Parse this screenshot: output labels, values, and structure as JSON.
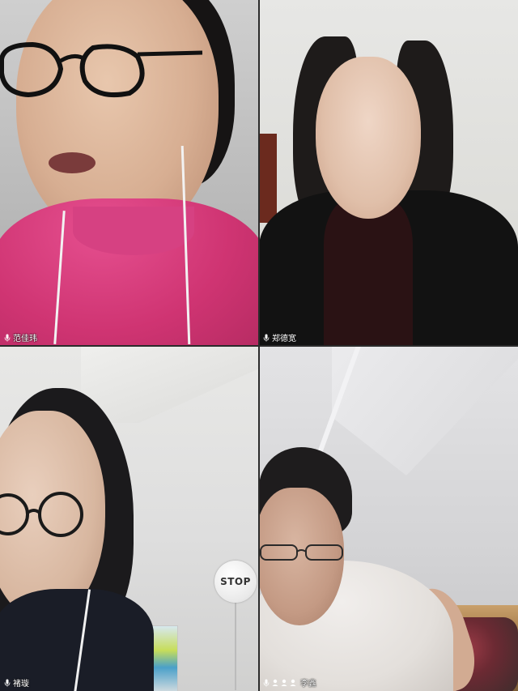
{
  "participants": [
    {
      "name": "范佳玮",
      "icon": "microphone-icon"
    },
    {
      "name": "郑德宽",
      "icon": "microphone-icon"
    },
    {
      "name": "褚璇",
      "icon": "microphone-icon"
    },
    {
      "name": "李鑫",
      "icon": "microphone-icon",
      "extra_icons": [
        "audio-wave-icon",
        "audio-wave-icon",
        "audio-wave-icon"
      ]
    }
  ],
  "colors": {
    "label_text": "#ffffff",
    "divider": "#2b2b2b"
  }
}
